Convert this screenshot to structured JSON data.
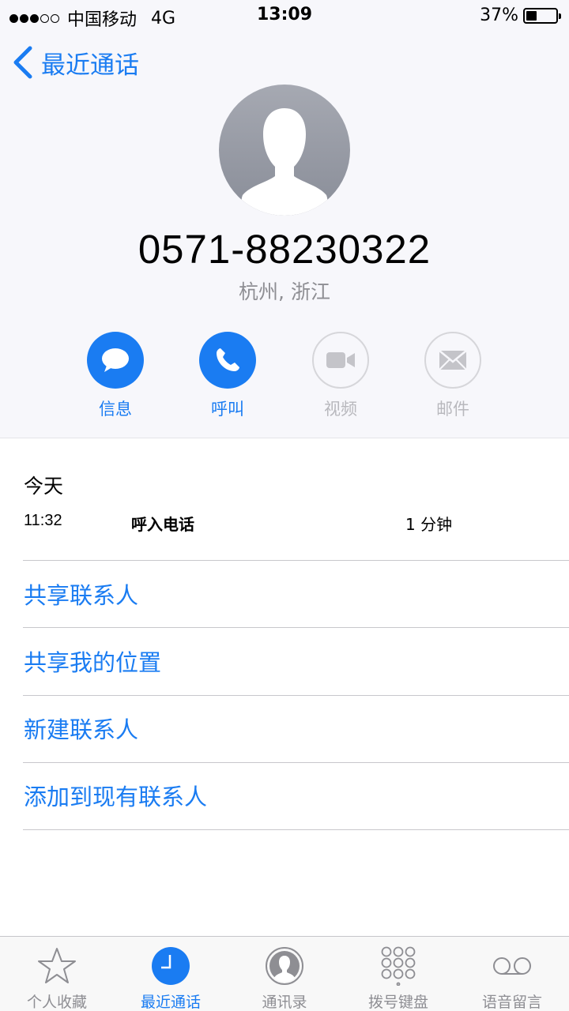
{
  "status_bar": {
    "carrier": "中国移动",
    "network": "4G",
    "time": "13:09",
    "battery_percent": "37%",
    "battery_level": 0.37,
    "signal_bars": 3
  },
  "nav": {
    "back_label": "最近通话"
  },
  "contact": {
    "number": "0571-88230322",
    "location": "杭州, 浙江"
  },
  "actions": [
    {
      "label": "信息",
      "icon": "message-icon",
      "enabled": true
    },
    {
      "label": "呼叫",
      "icon": "phone-icon",
      "enabled": true
    },
    {
      "label": "视频",
      "icon": "video-icon",
      "enabled": false
    },
    {
      "label": "邮件",
      "icon": "mail-icon",
      "enabled": false
    }
  ],
  "history": {
    "date": "今天",
    "entries": [
      {
        "time": "11:32",
        "type": "呼入电话",
        "duration": "1 分钟"
      }
    ]
  },
  "options": [
    "共享联系人",
    "共享我的位置",
    "新建联系人",
    "添加到现有联系人"
  ],
  "tabs": [
    {
      "label": "个人收藏",
      "icon": "star-icon",
      "active": false
    },
    {
      "label": "最近通话",
      "icon": "clock-icon",
      "active": true
    },
    {
      "label": "通讯录",
      "icon": "contacts-icon",
      "active": false
    },
    {
      "label": "拨号键盘",
      "icon": "keypad-icon",
      "active": false
    },
    {
      "label": "语音留言",
      "icon": "voicemail-icon",
      "active": false
    }
  ],
  "colors": {
    "accent": "#1a7cf2",
    "disabled": "#b8b8bd",
    "secondary_text": "#8e8e93"
  }
}
